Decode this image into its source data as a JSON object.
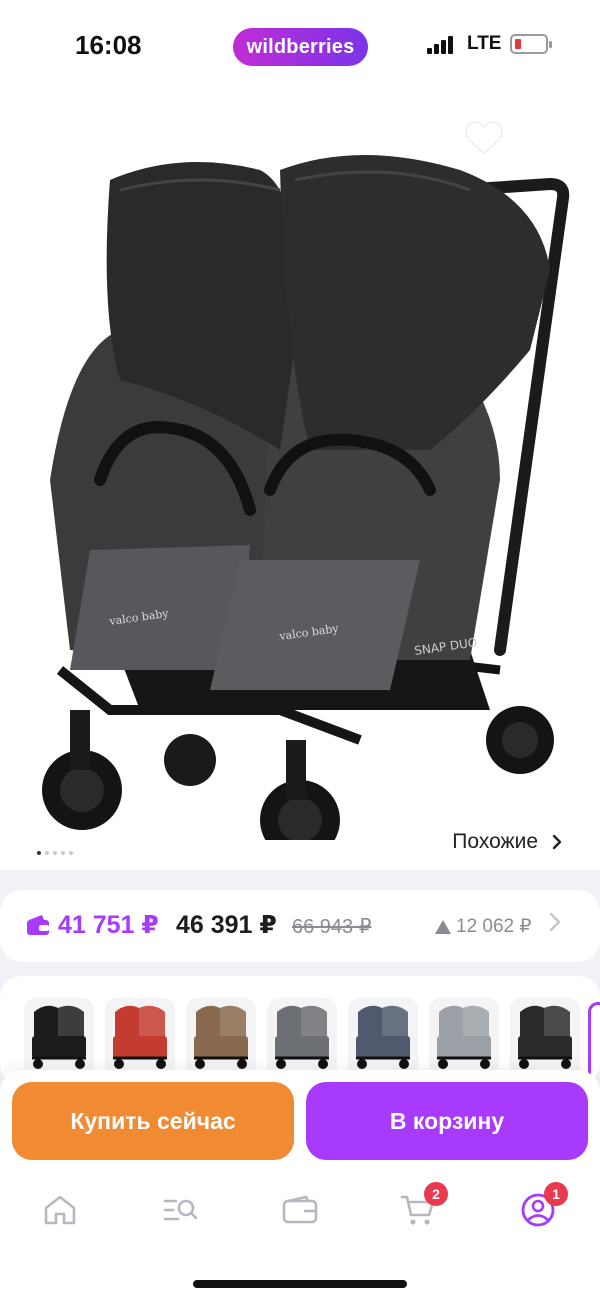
{
  "status_bar": {
    "time": "16:08",
    "brand": "wildberries",
    "network": "LTE",
    "battery_color": "#e8393a"
  },
  "product": {
    "similar_label": "Похожие",
    "image_dots_total": 5,
    "image_dot_active": 1,
    "stroller_labels": {
      "canopy_brand": "valco baby",
      "model_print": "SNAP DUO"
    },
    "icons": [
      "back-arrow-icon",
      "heart-icon",
      "share-icon"
    ]
  },
  "price": {
    "wallet_price": "41 751 ₽",
    "price": "46 391 ₽",
    "old_price": "66 943 ₽",
    "difference": "12 062 ₽"
  },
  "colors": {
    "variants": [
      "black",
      "red",
      "brown",
      "grey",
      "denim",
      "light-grey",
      "dark"
    ],
    "swatch_colors": [
      "#1c1c1e",
      "#c43b2f",
      "#8a6a4e",
      "#6c6f73",
      "#4f5a6e",
      "#9aa0a6",
      "#2d2a2c"
    ]
  },
  "actions": {
    "buy_now": "Купить сейчас",
    "add_to_cart": "В корзину",
    "buy_color": "#f08a33",
    "cart_color": "#a73afd"
  },
  "tab_bar": {
    "items": [
      "home-icon",
      "catalog-search-icon",
      "wallet-icon",
      "cart-icon",
      "profile-icon"
    ],
    "cart_badge": "2",
    "profile_badge": "1",
    "accent": "#a73afd"
  }
}
